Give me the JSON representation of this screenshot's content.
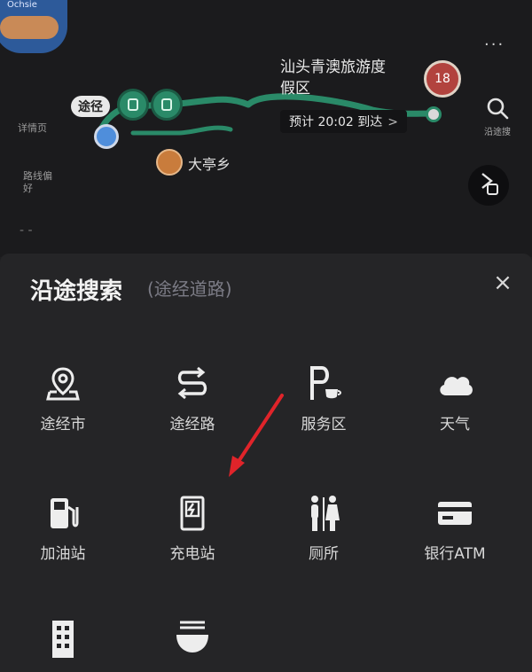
{
  "map": {
    "thumb_label": "Ochsie",
    "more_label": "···",
    "via_bubble": "途径",
    "waypoint_badge": "",
    "waypoint_label": "大亭乡",
    "destination_title": "汕头青澳旅游度假区",
    "destination_badge": "18",
    "eta_text": "预计 20:02 到达",
    "eta_chevron": ">",
    "search_label": "沿途搜",
    "side_label_1": "详情页",
    "side_label_2": "路线偏好",
    "side_dash": "- -",
    "route_color": "#2a8a68"
  },
  "sheet": {
    "title": "沿途搜索",
    "subtitle": "(途经道路)",
    "close_icon": "×",
    "items": [
      {
        "label": "途经市",
        "icon": "city-pin-icon"
      },
      {
        "label": "途经路",
        "icon": "route-s-icon"
      },
      {
        "label": "服务区",
        "icon": "service-area-icon"
      },
      {
        "label": "天气",
        "icon": "cloud-icon"
      },
      {
        "label": "加油站",
        "icon": "gas-station-icon"
      },
      {
        "label": "充电站",
        "icon": "charging-station-icon"
      },
      {
        "label": "厕所",
        "icon": "restroom-icon"
      },
      {
        "label": "银行ATM",
        "icon": "atm-card-icon"
      },
      {
        "label": "",
        "icon": "hotel-icon"
      },
      {
        "label": "",
        "icon": "food-bowl-icon"
      }
    ]
  },
  "annotation": {
    "arrow_color": "#e0242a"
  }
}
